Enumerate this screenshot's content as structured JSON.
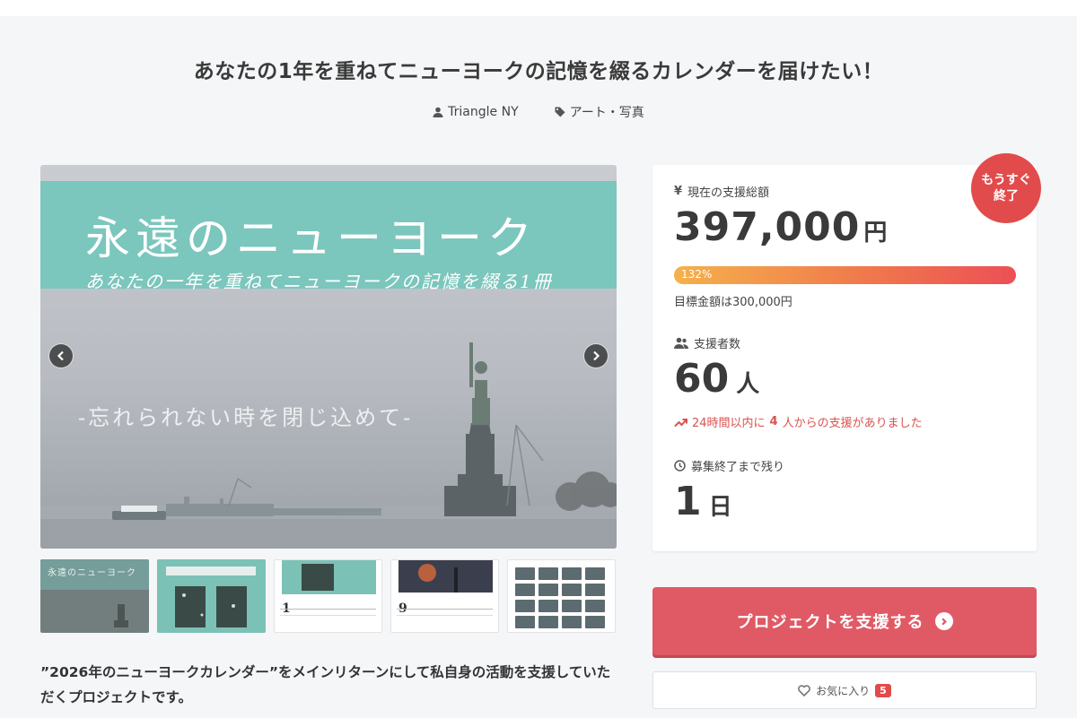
{
  "project": {
    "title": "あなたの1年を重ねてニューヨークの記憶を綴るカレンダーを届けたい！",
    "owner": "Triangle NY",
    "category": "アート・写真",
    "description": "”2026年のニューヨークカレンダー”をメインリターンにして私自身の活動を支援していただくプロジェクトです。"
  },
  "hero": {
    "title": "永遠のニューヨーク",
    "subtitle": "あなたの一年を重ねてニューヨークの記憶を綴る1冊",
    "tagline": "-忘れられない時を閉じ込めて-"
  },
  "thumbnails": {
    "t1_text": "永遠のニューヨーク",
    "t3_month": "1",
    "t4_month": "9"
  },
  "stats": {
    "badge_line1": "もうすぐ",
    "badge_line2": "終了",
    "amount_label": "現在の支援総額",
    "amount": "397,000",
    "amount_unit": "円",
    "progress_percent": 132,
    "progress_text": "132%",
    "goal_text": "目標金額は300,000円",
    "backers_label": "支援者数",
    "backers": "60",
    "backers_unit": "人",
    "recent_pre": "24時間以内に",
    "recent_count": "4",
    "recent_post": "人からの支援がありました",
    "remaining_label": "募集終了まで残り",
    "remaining": "1",
    "remaining_unit": "日"
  },
  "actions": {
    "support_label": "プロジェクトを支援する",
    "favorite_label": "お気に入り",
    "favorite_count": "5"
  },
  "colors": {
    "accent": "#e05a66",
    "badge": "#e24b4b",
    "hero_band": "#7bc6bd",
    "alert_text": "#d9534f"
  },
  "icons": {
    "owner": "user-icon",
    "category": "tag-icon",
    "amount": "yen-icon",
    "backers": "users-icon",
    "recent": "trend-up-icon",
    "remaining": "clock-icon",
    "support": "chevron-circle-right-icon",
    "favorite": "heart-icon"
  }
}
